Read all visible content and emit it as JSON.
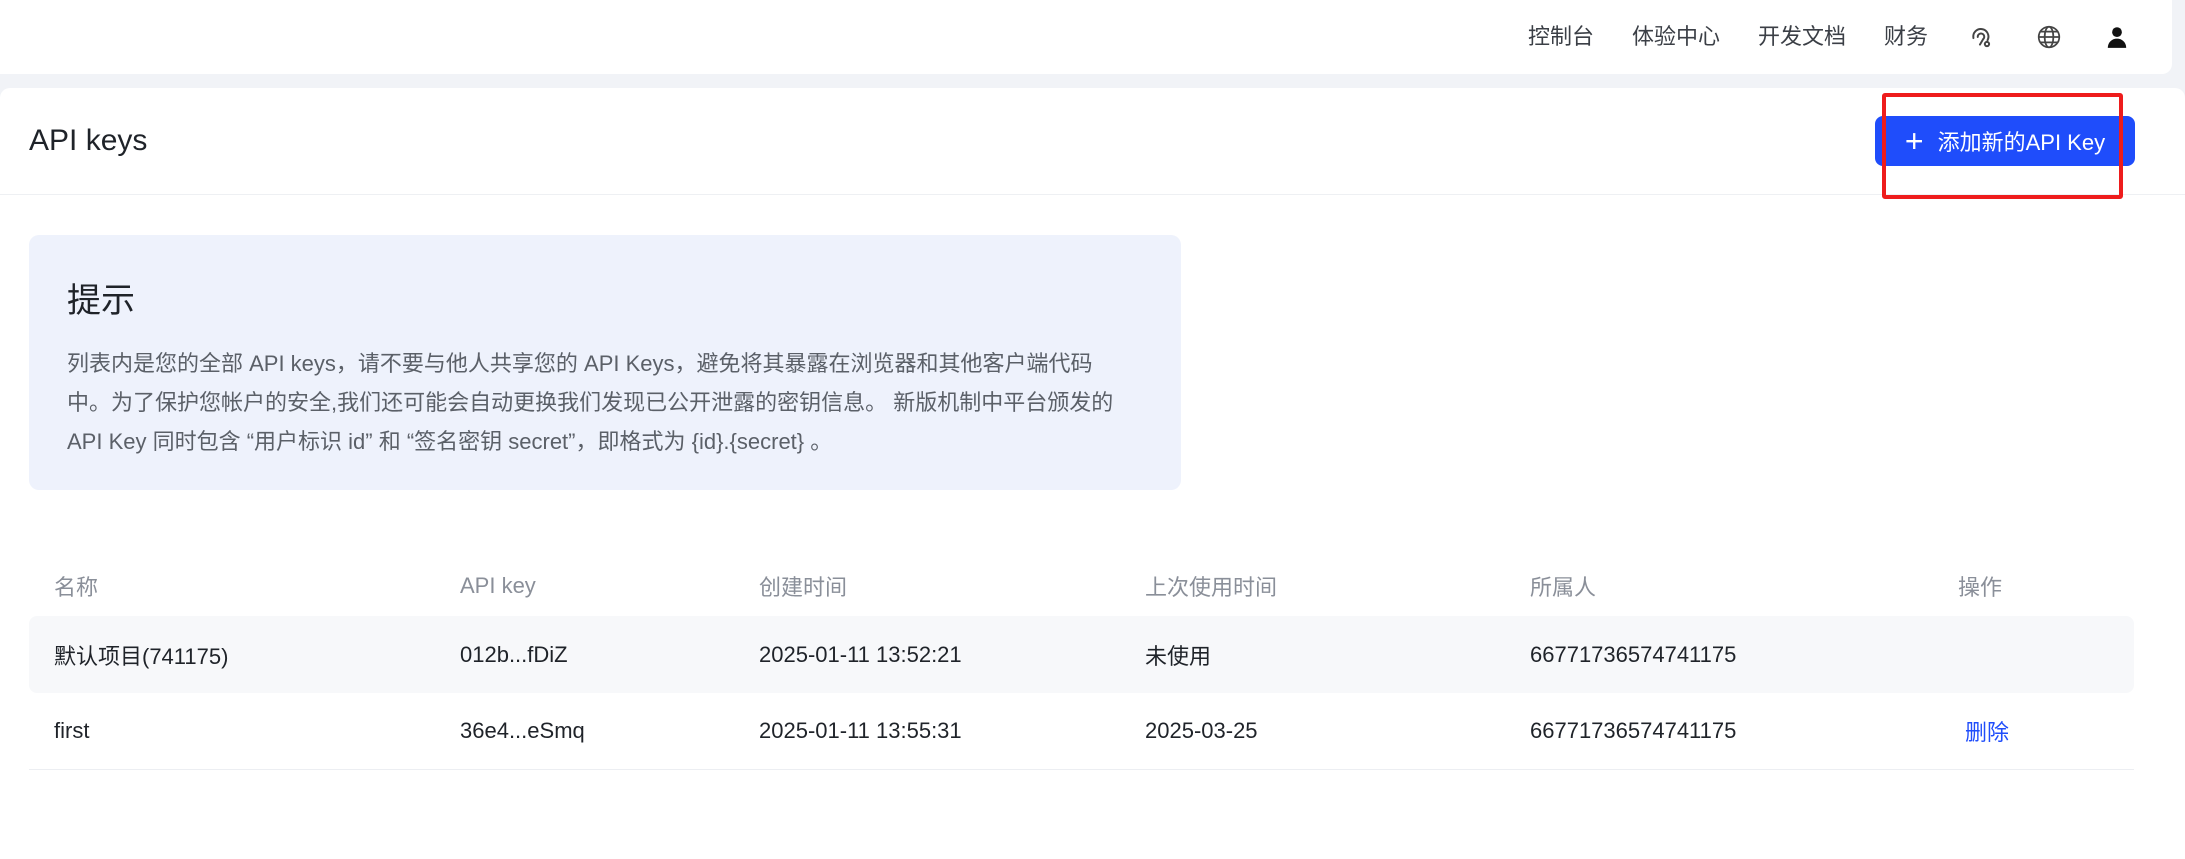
{
  "topbar": {
    "links": [
      "控制台",
      "体验中心",
      "开发文档",
      "财务"
    ],
    "icons": [
      "support-icon",
      "globe-icon",
      "user-icon"
    ]
  },
  "header": {
    "title": "API keys",
    "add_button_label": "添加新的API Key",
    "add_button_icon": "plus-icon"
  },
  "tip": {
    "title": "提示",
    "lines": [
      "列表内是您的全部 API keys，请不要与他人共享您的 API Keys，避免将其暴露在浏览器和其他客户端代码",
      "中。为了保护您帐户的安全,我们还可能会自动更换我们发现已公开泄露的密钥信息。 新版机制中平台颁发的",
      "API Key 同时包含 “用户标识 id” 和 “签名密钥 secret”，即格式为 {id}.{secret} 。"
    ]
  },
  "table": {
    "columns": [
      "名称",
      "API key",
      "创建时间",
      "上次使用时间",
      "所属人",
      "操作"
    ],
    "rows": [
      {
        "name": "默认项目(741175)",
        "key": "012b...fDiZ",
        "created": "2025-01-11 13:52:21",
        "last_used": "未使用",
        "owner": "66771736574741175",
        "action": ""
      },
      {
        "name": "first",
        "key": "36e4...eSmq",
        "created": "2025-01-11 13:55:31",
        "last_used": "2025-03-25",
        "owner": "66771736574741175",
        "action": "删除"
      }
    ]
  },
  "colors": {
    "primary": "#1f4dfb",
    "highlight": "#ee1c1c",
    "tip_bg": "#eef2fc"
  }
}
